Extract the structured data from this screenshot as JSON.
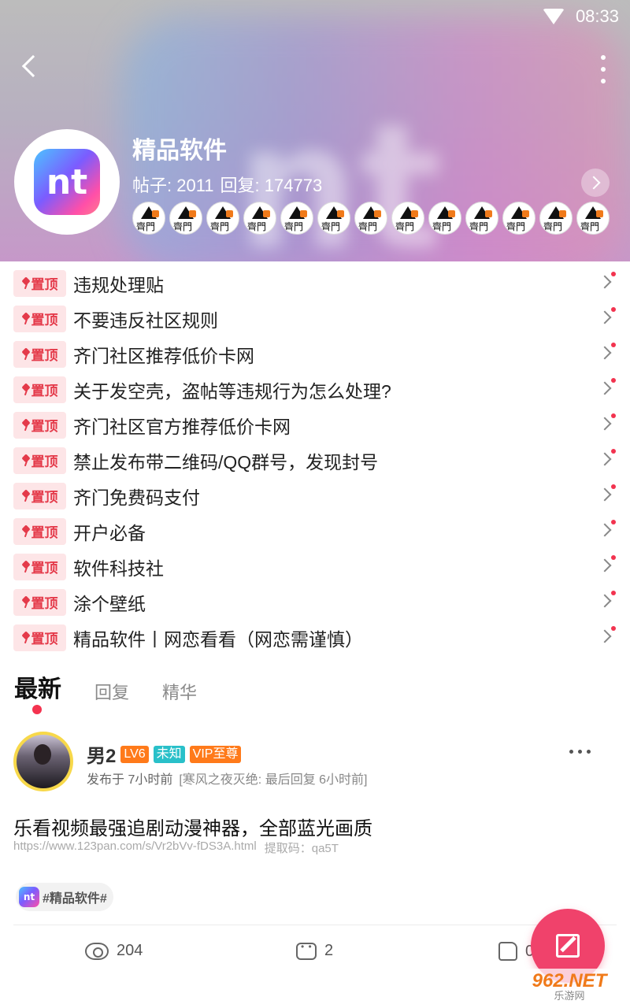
{
  "status_bar": {
    "time": "08:33"
  },
  "forum": {
    "avatar_text": "nt",
    "title": "精品软件",
    "posts_label": "帖子: 2011",
    "replies_label": "回复: 174773",
    "member_badge_text": "齊門"
  },
  "pinned": [
    {
      "badge": "置顶",
      "title": "违规处理贴"
    },
    {
      "badge": "置顶",
      "title": "不要违反社区规则"
    },
    {
      "badge": "置顶",
      "title": "齐门社区推荐低价卡网"
    },
    {
      "badge": "置顶",
      "title": "关于发空壳，盗帖等违规行为怎么处理?"
    },
    {
      "badge": "置顶",
      "title": "齐门社区官方推荐低价卡网"
    },
    {
      "badge": "置顶",
      "title": "禁止发布带二维码/QQ群号，发现封号"
    },
    {
      "badge": "置顶",
      "title": "齐门免费码支付"
    },
    {
      "badge": "置顶",
      "title": "开户必备"
    },
    {
      "badge": "置顶",
      "title": "软件科技社"
    },
    {
      "badge": "置顶",
      "title": "涂个壁纸"
    },
    {
      "badge": "置顶",
      "title": "精品软件丨网恋看看（网恋需谨慎）"
    }
  ],
  "tabs": [
    {
      "label": "最新",
      "active": true
    },
    {
      "label": "回复",
      "active": false
    },
    {
      "label": "精华",
      "active": false
    }
  ],
  "post": {
    "user_name": "男2",
    "level": "LV6",
    "gender": "未知",
    "vip": "VIP至尊",
    "posted": "发布于 7小时前",
    "last_reply": "[寒风之夜灭绝: 最后回复 6小时前]",
    "title": "乐看视频最强追剧动漫神器，全部蓝光画质",
    "link": "https://www.123pan.com/s/Vr2bVv-fDS3A.html",
    "code": "提取码：qa5T",
    "tag_icon": "nt",
    "tag": "#精品软件#",
    "views": "204",
    "comments": "2",
    "likes": "0"
  },
  "watermark": {
    "main": "962.NET",
    "sub": "乐游网"
  },
  "colors": {
    "accent": "#f0426b",
    "pin_bg": "#fde5e7",
    "pin_text": "#e43a4a",
    "level_badge": "#ff7a1a",
    "unknown_badge": "#29c0c9"
  }
}
